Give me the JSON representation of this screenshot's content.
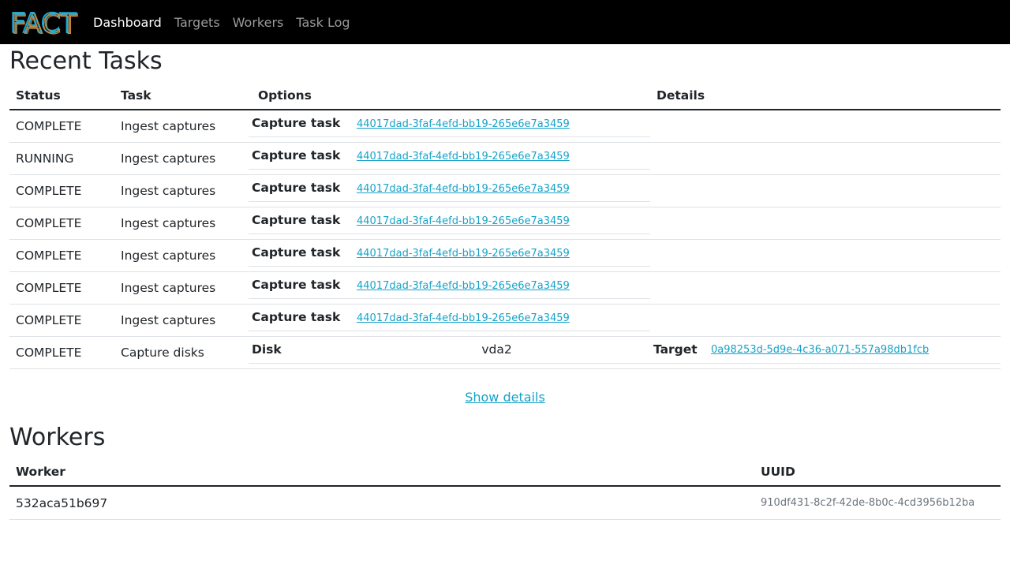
{
  "navbar": {
    "logo_text": "FACT",
    "links": [
      "Dashboard",
      "Targets",
      "Workers",
      "Task Log"
    ]
  },
  "recent_tasks": {
    "title": "Recent Tasks",
    "headers": [
      "Status",
      "Task",
      "Options",
      "Details"
    ],
    "rows": [
      {
        "status": "COMPLETE",
        "task": "Ingest captures",
        "opt_label": "Capture task",
        "opt_value": "44017dad-3faf-4efd-bb19-265e6e7a3459"
      },
      {
        "status": "RUNNING",
        "task": "Ingest captures",
        "opt_label": "Capture task",
        "opt_value": "44017dad-3faf-4efd-bb19-265e6e7a3459"
      },
      {
        "status": "COMPLETE",
        "task": "Ingest captures",
        "opt_label": "Capture task",
        "opt_value": "44017dad-3faf-4efd-bb19-265e6e7a3459"
      },
      {
        "status": "COMPLETE",
        "task": "Ingest captures",
        "opt_label": "Capture task",
        "opt_value": "44017dad-3faf-4efd-bb19-265e6e7a3459"
      },
      {
        "status": "COMPLETE",
        "task": "Ingest captures",
        "opt_label": "Capture task",
        "opt_value": "44017dad-3faf-4efd-bb19-265e6e7a3459"
      },
      {
        "status": "COMPLETE",
        "task": "Ingest captures",
        "opt_label": "Capture task",
        "opt_value": "44017dad-3faf-4efd-bb19-265e6e7a3459"
      },
      {
        "status": "COMPLETE",
        "task": "Ingest captures",
        "opt_label": "Capture task",
        "opt_value": "44017dad-3faf-4efd-bb19-265e6e7a3459"
      }
    ],
    "last_row": {
      "status": "COMPLETE",
      "task": "Capture disks",
      "opt_label": "Disk",
      "opt_value": "vda2",
      "detail_label": "Target",
      "detail_value": "0a98253d-5d9e-4c36-a071-557a98db1fcb"
    },
    "show_details": "Show details"
  },
  "workers": {
    "title": "Workers",
    "headers": [
      "Worker",
      "UUID"
    ],
    "rows": [
      {
        "worker": "532aca51b697",
        "uuid": "910df431-8c2f-42de-8b0c-4cd3956b12ba"
      }
    ]
  },
  "colors": {
    "navbar_bg": "#000000",
    "link": "#17a2c8",
    "logo_blue": "#1aa7d6",
    "logo_orange": "#f08a24"
  }
}
